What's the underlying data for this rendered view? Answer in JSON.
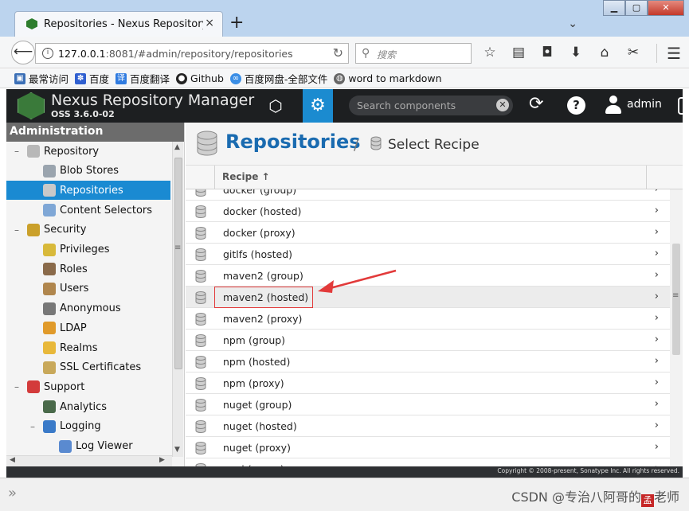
{
  "browser": {
    "tab_title": "Repositories - Nexus Repository M",
    "tab_close": "×",
    "new_tab": "+",
    "url_host": "127.0.0.1",
    "url_rest": ":8081/#admin/repository/repositories",
    "search_placeholder": "搜索",
    "bookmarks": [
      "最常访问",
      "百度",
      "百度翻译",
      "Github",
      "百度网盘-全部文件",
      "word to markdown"
    ]
  },
  "nexus": {
    "title": "Nexus Repository Manager",
    "version": "OSS 3.6.0-02",
    "search_placeholder": "Search components",
    "user": "admin"
  },
  "sidebar": {
    "header": "Administration",
    "items": [
      {
        "label": "Repository",
        "level": 1,
        "expander": "–",
        "color": "#b8b8b8"
      },
      {
        "label": "Blob Stores",
        "level": 2,
        "color": "#9aa4ae"
      },
      {
        "label": "Repositories",
        "level": 2,
        "color": "#c9c9c9",
        "selected": true
      },
      {
        "label": "Content Selectors",
        "level": 2,
        "color": "#7fa7d6"
      },
      {
        "label": "Security",
        "level": 1,
        "expander": "–",
        "color": "#caa02a"
      },
      {
        "label": "Privileges",
        "level": 2,
        "color": "#d8b93a"
      },
      {
        "label": "Roles",
        "level": 2,
        "color": "#8a6a4a"
      },
      {
        "label": "Users",
        "level": 2,
        "color": "#b0864d"
      },
      {
        "label": "Anonymous",
        "level": 2,
        "color": "#777777"
      },
      {
        "label": "LDAP",
        "level": 2,
        "color": "#e09a2a"
      },
      {
        "label": "Realms",
        "level": 2,
        "color": "#e8b83a"
      },
      {
        "label": "SSL Certificates",
        "level": 2,
        "color": "#c8a85a"
      },
      {
        "label": "Support",
        "level": 1,
        "expander": "–",
        "color": "#d33b3b"
      },
      {
        "label": "Analytics",
        "level": 2,
        "color": "#4a6a4a"
      },
      {
        "label": "Logging",
        "level": 2,
        "expander": "–",
        "color": "#3a7ac8"
      },
      {
        "label": "Log Viewer",
        "level": 3,
        "color": "#5a8ad0"
      }
    ]
  },
  "main": {
    "title": "Repositories",
    "breadcrumb_sep": "/",
    "breadcrumb": "Select Recipe",
    "column_header": "Recipe ↑",
    "rows": [
      {
        "name": "docker (group)",
        "chevron": "›"
      },
      {
        "name": "docker (hosted)",
        "chevron": "›"
      },
      {
        "name": "docker (proxy)",
        "chevron": "›"
      },
      {
        "name": "gitlfs (hosted)",
        "chevron": "›"
      },
      {
        "name": "maven2 (group)",
        "chevron": "›"
      },
      {
        "name": "maven2 (hosted)",
        "chevron": "›",
        "highlighted": true
      },
      {
        "name": "maven2 (proxy)",
        "chevron": "›"
      },
      {
        "name": "npm (group)",
        "chevron": "›"
      },
      {
        "name": "npm (hosted)",
        "chevron": "›"
      },
      {
        "name": "npm (proxy)",
        "chevron": "›"
      },
      {
        "name": "nuget (group)",
        "chevron": "›"
      },
      {
        "name": "nuget (hosted)",
        "chevron": "›"
      },
      {
        "name": "nuget (proxy)",
        "chevron": "›"
      },
      {
        "name": "pypi (group)",
        "chevron": "›"
      }
    ]
  },
  "footer": {
    "copyright": "Copyright © 2008-present, Sonatype Inc. All rights reserved."
  },
  "watermark": {
    "text": "CSDN @专治八阿哥的",
    "seal": "孟",
    "suffix": "老师"
  },
  "colors": {
    "accent": "#1a8ad2",
    "header_bg": "#1d1f21",
    "title_blue": "#1a6bb0",
    "annotation_red": "#e23a3a"
  }
}
